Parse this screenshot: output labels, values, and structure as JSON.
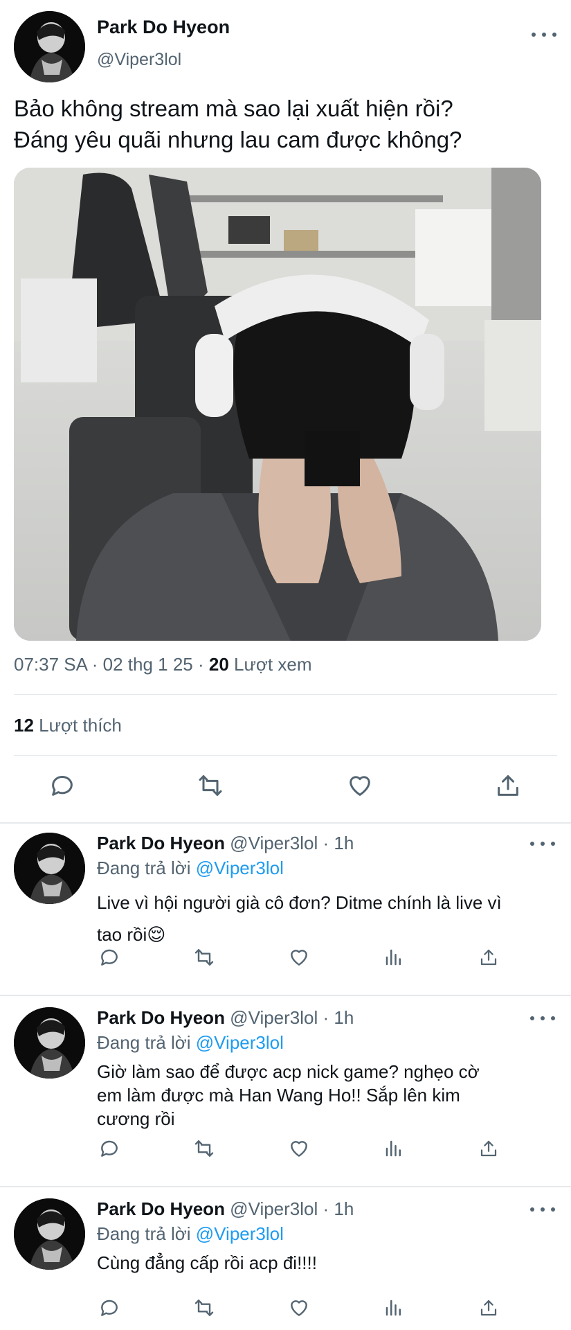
{
  "main_tweet": {
    "author_name": "Park Do Hyeon",
    "author_handle": "@Viper3lol",
    "text_line1": "Bảo không stream mà sao lại xuất hiện rồi?",
    "text_line2": "Đáng yêu quãi nhưng lau cam được không?",
    "time": "07:37 SA · 02 thg 1 25 · ",
    "views_count": "20",
    "views_label": " Lượt xem",
    "likes_count": "12",
    "likes_label": " Lượt thích",
    "actions": [
      "reply-icon",
      "retweet-icon",
      "like-icon",
      "share-icon"
    ]
  },
  "replies": [
    {
      "author_name": "Park Do Hyeon",
      "author_handle": " @Viper3lol · 1h",
      "replying_prefix": "Đang trả lời ",
      "replying_to": "@Viper3lol",
      "text_line1": "Live vì hội người già cô đơn? Ditme chính là live vì",
      "text_line2": "tao rồi😌",
      "text_line3": ""
    },
    {
      "author_name": "Park Do Hyeon",
      "author_handle": " @Viper3lol · 1h",
      "replying_prefix": "Đang trả lời ",
      "replying_to": "@Viper3lol",
      "text_line1": "Giờ làm sao để được acp nick game? nghẹo cờ",
      "text_line2": "em làm được mà Han Wang Ho!! Sắp lên kim",
      "text_line3": "cương rồi"
    },
    {
      "author_name": "Park Do Hyeon",
      "author_handle": " @Viper3lol · 1h",
      "replying_prefix": "Đang trả lời ",
      "replying_to": "@Viper3lol",
      "text_line1": "Cùng đẳng cấp rồi acp đi!!!!",
      "text_line2": "",
      "text_line3": ""
    }
  ],
  "colors": {
    "text": "#0f1419",
    "secondary": "#536471",
    "link": "#1d9bf0",
    "divider": "#e6e9ec"
  },
  "reply_actions": [
    "reply-icon",
    "retweet-icon",
    "like-icon",
    "views-icon",
    "share-icon"
  ]
}
